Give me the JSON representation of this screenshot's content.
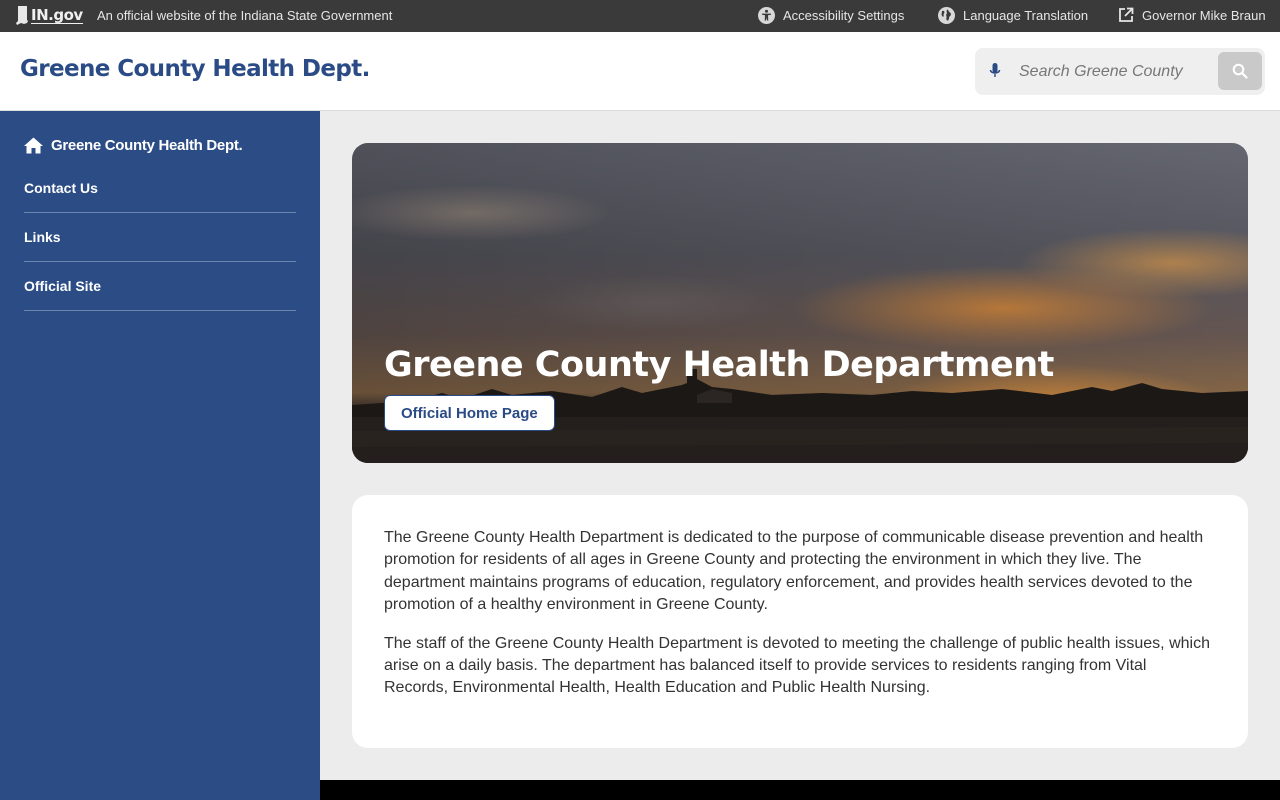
{
  "topbar": {
    "logo_text": "IN.gov",
    "official_text": "An official website of the Indiana State Government",
    "accessibility_label": "Accessibility Settings",
    "language_label": "Language Translation",
    "governor_label": "Governor Mike Braun"
  },
  "header": {
    "site_title": "Greene County Health Dept.",
    "search_placeholder": "Search Greene County"
  },
  "sidebar": {
    "home_label": "Greene County Health Dept.",
    "items": [
      {
        "label": "Contact Us"
      },
      {
        "label": "Links"
      },
      {
        "label": "Official Site"
      }
    ]
  },
  "hero": {
    "title": "Greene County Health Department",
    "button_label": "Official Home Page"
  },
  "content": {
    "paragraphs": [
      "The Greene County Health Department is dedicated to the purpose of communicable disease prevention and health promotion for residents of all ages in Greene County and protecting the environment in which they live. The department maintains programs of education, regulatory enforcement, and provides health services devoted to the promotion of a healthy environment in Greene County.",
      "The staff of the Greene County Health Department is devoted to meeting the challenge of public health issues, which arise on a daily basis. The department has balanced itself to provide services to residents ranging from Vital Records, Environmental Health, Health Education and Public Health Nursing."
    ]
  },
  "colors": {
    "brand_blue": "#2a4b86",
    "sidebar_bg": "#2b4c85",
    "topbar_bg": "#3a3a3a",
    "page_bg": "#ececec"
  },
  "icons": {
    "accessibility": "accessibility-icon",
    "language": "globe-icon",
    "external": "external-link-icon",
    "microphone": "microphone-icon",
    "search": "search-icon",
    "home": "home-icon"
  }
}
